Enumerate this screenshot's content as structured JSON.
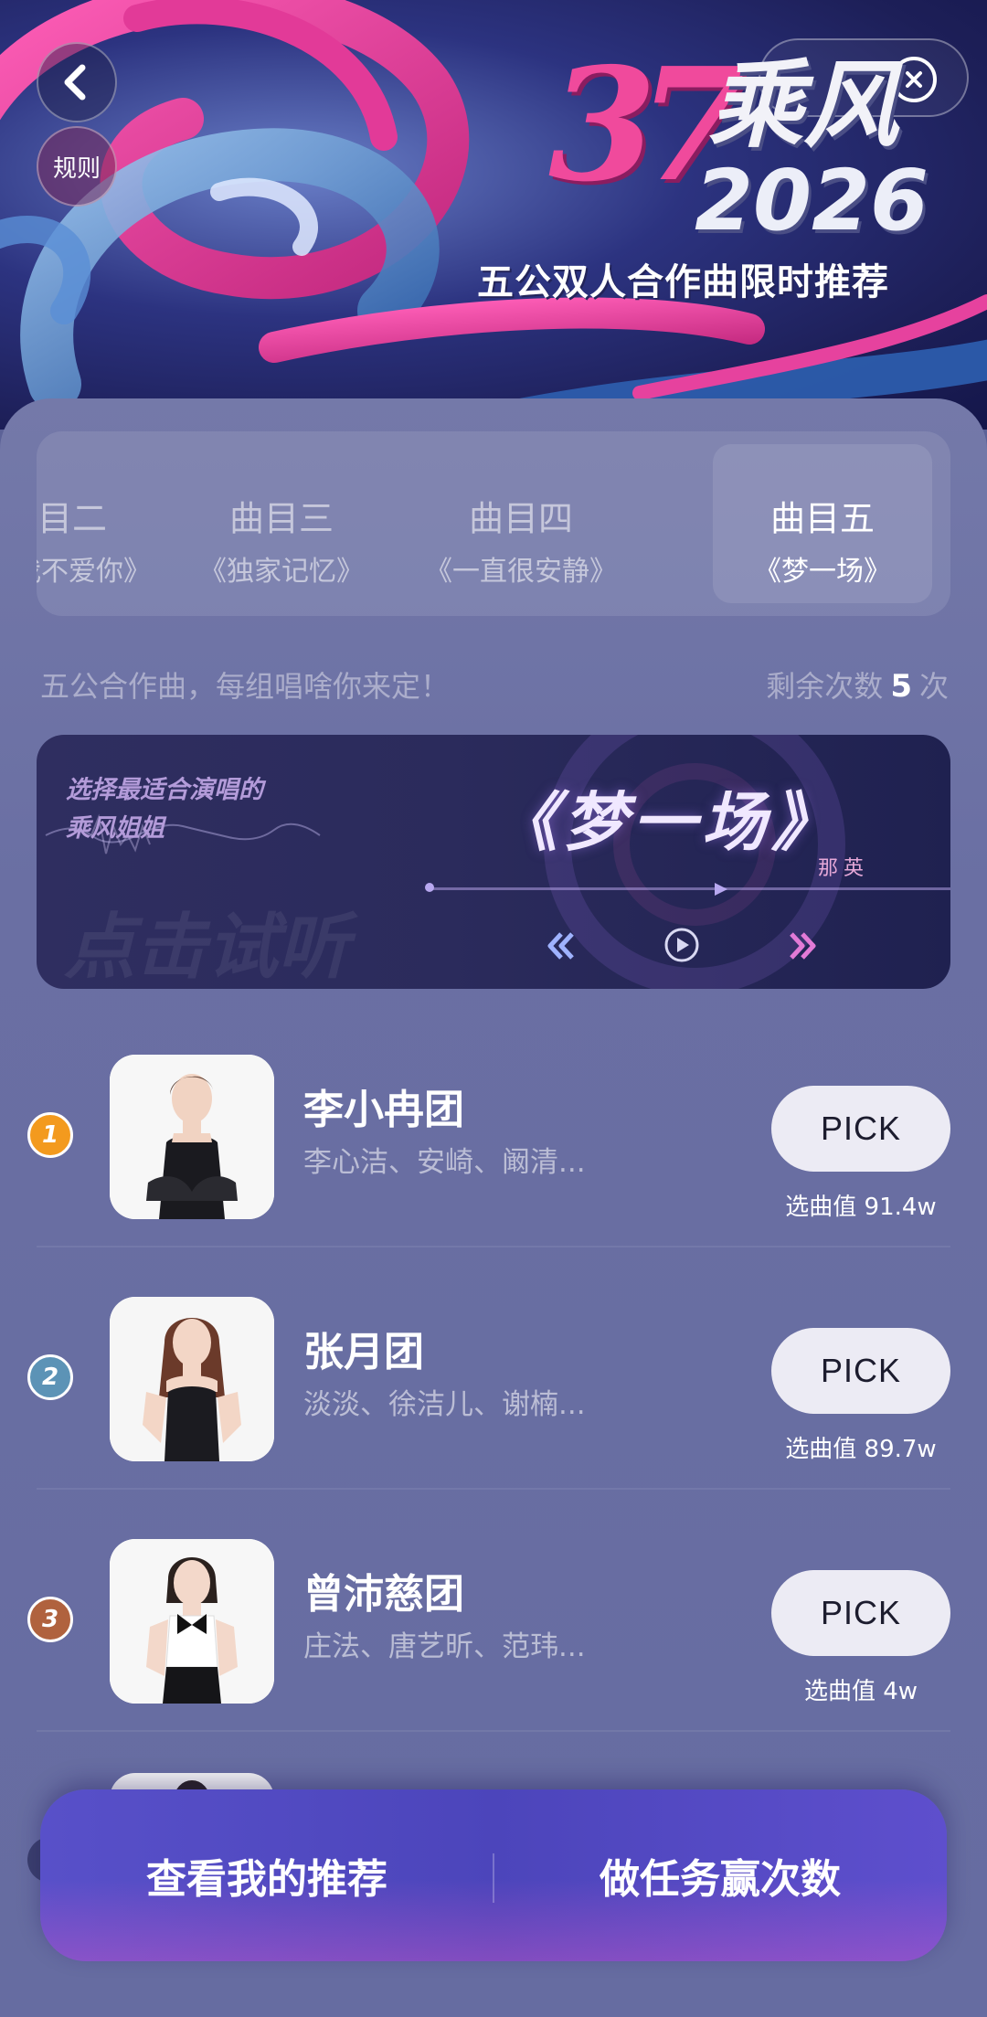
{
  "hero": {
    "logo_glyph": "37",
    "title": "乘风",
    "year": "2026",
    "subtitle": "五公双人合作曲限时推荐",
    "rules_label": "规则"
  },
  "tabs": [
    {
      "label": "曲目二",
      "song": "《说我不爱你》",
      "active": false
    },
    {
      "label": "曲目三",
      "song": "《独家记忆》",
      "active": false
    },
    {
      "label": "曲目四",
      "song": "《一直很安静》",
      "active": false
    },
    {
      "label": "曲目五",
      "song": "《梦一场》",
      "active": true
    }
  ],
  "hint": "五公合作曲，每组唱啥你来定！",
  "remaining": {
    "prefix": "剩余次数",
    "count": "5",
    "suffix": "次"
  },
  "banner": {
    "line1": "选择最适合演唱的",
    "line2": "乘风姐姐",
    "song_title": "《梦一场》",
    "singer": "那英",
    "bg_text": "点击试听"
  },
  "groups": [
    {
      "rank": "1",
      "rank_color": "#f39a1e",
      "name": "李小冉团",
      "members": "李心洁、安崎、阚清...",
      "pick_label": "PICK",
      "score": "选曲值 91.4w",
      "photo": "portrait-black-dress"
    },
    {
      "rank": "2",
      "rank_color": "#5c93b6",
      "name": "张月团",
      "members": "淡淡、徐洁儿、谢楠...",
      "pick_label": "PICK",
      "score": "选曲值 89.7w",
      "photo": "portrait-corset-dress"
    },
    {
      "rank": "3",
      "rank_color": "#b0623e",
      "name": "曾沛慈团",
      "members": "庄法、唐艺昕、范玮...",
      "pick_label": "PICK",
      "score": "选曲值 4w",
      "photo": "portrait-bow-tie"
    }
  ],
  "bottom": {
    "recommend_label": "查看我的推荐",
    "task_label": "做任务赢次数"
  },
  "colors": {
    "accent_pink": "#f04a9c",
    "bottom_bar": "#4c45bb",
    "background": "#6a6fa3"
  }
}
